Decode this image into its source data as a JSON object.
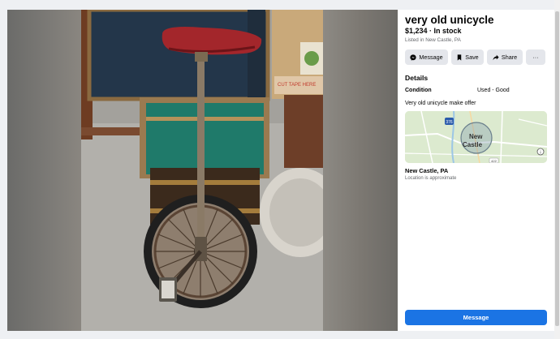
{
  "listing": {
    "title": "very old unicycle",
    "price_status": "$1,234 · In stock",
    "listed_in": "Listed in New Castle, PA"
  },
  "actions": {
    "message": "Message",
    "save": "Save",
    "share": "Share",
    "more": "···"
  },
  "details": {
    "heading": "Details",
    "condition_label": "Condition",
    "condition_value": "Used - Good",
    "description": "Very old unicycle make offer"
  },
  "map": {
    "city_label_1": "New",
    "city_label_2": "Castle",
    "route_shield_1": "376",
    "route_shield_2": "422",
    "info_icon": "info-icon"
  },
  "location": {
    "name": "New Castle, PA",
    "note": "Location is approximate"
  },
  "primary_button": "Message",
  "colors": {
    "accent": "#1b74e4",
    "button_bg": "#e4e6eb"
  }
}
